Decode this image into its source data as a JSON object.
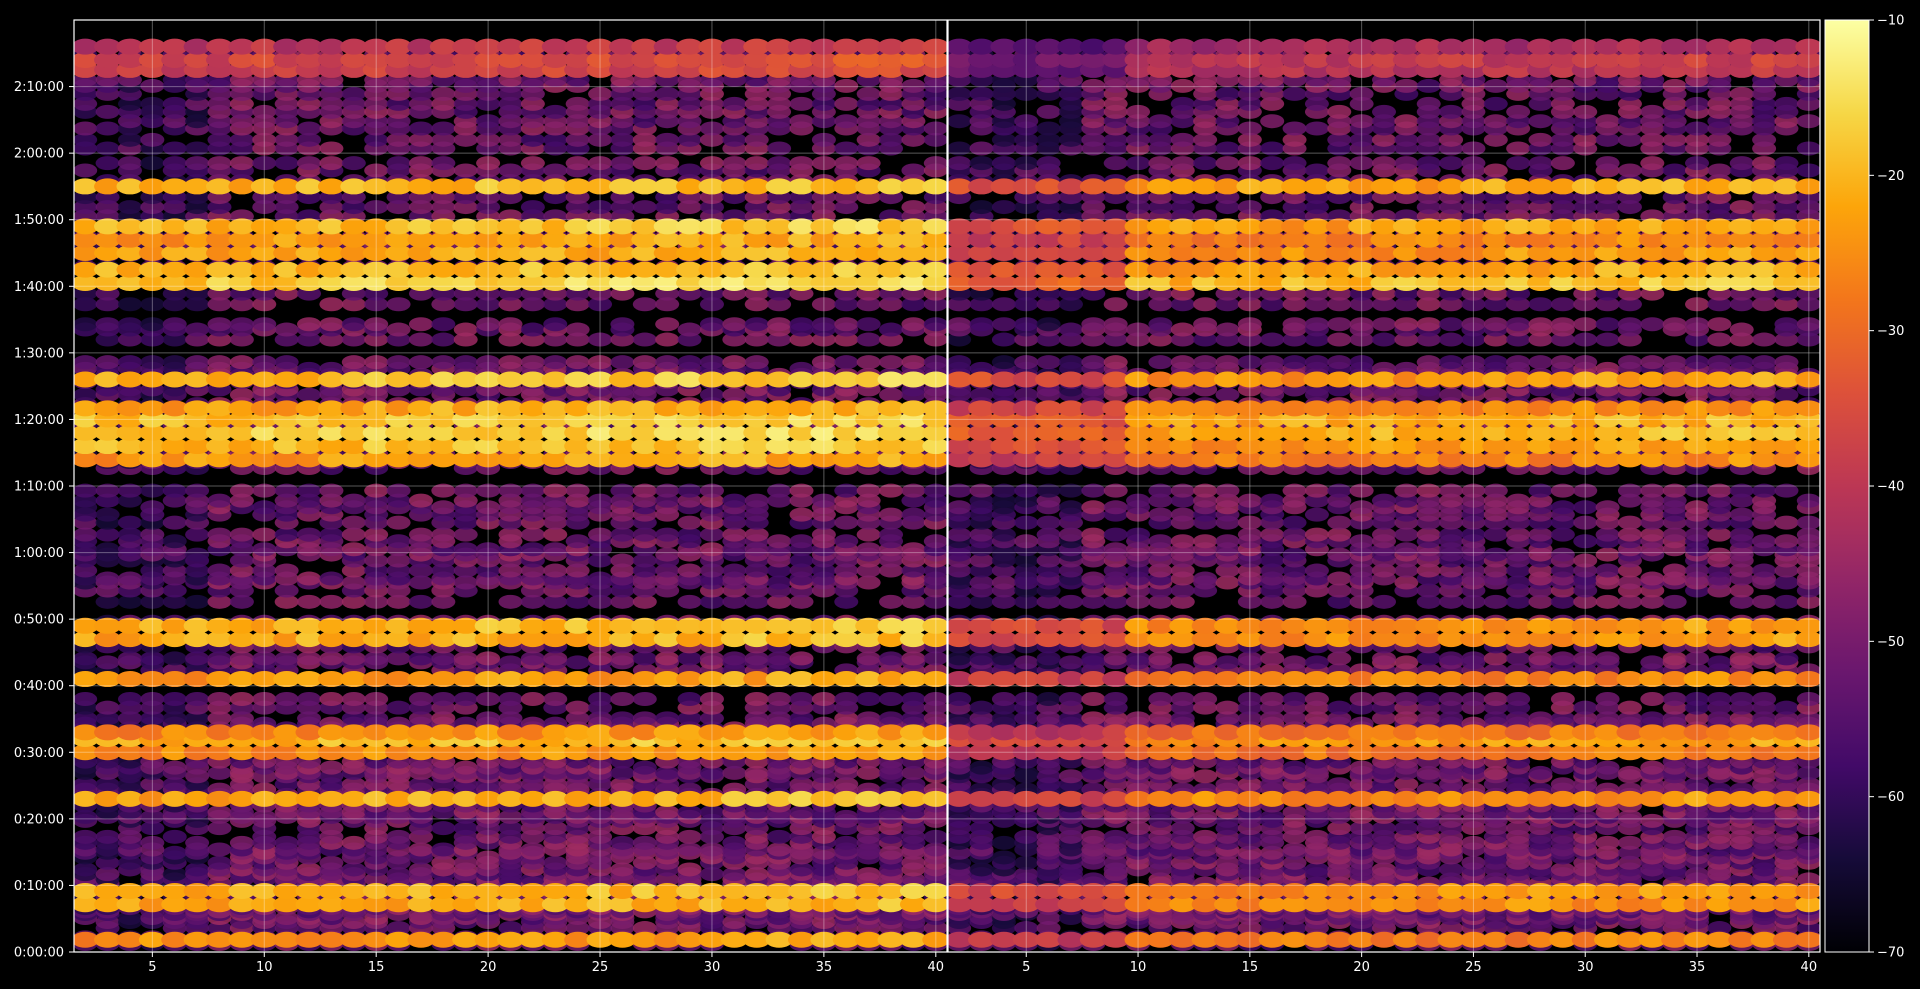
{
  "chart_data": [
    {
      "type": "heatmap",
      "panel": "left",
      "x_ticks": [
        5,
        10,
        15,
        20,
        25,
        30,
        35,
        40
      ],
      "xlim": [
        1.5,
        40.5
      ],
      "ylim_seconds": [
        0,
        8400
      ],
      "y_ticks": [
        "0:00:00",
        "0:10:00",
        "0:20:00",
        "0:30:00",
        "0:40:00",
        "0:50:00",
        "1:00:00",
        "1:10:00",
        "1:20:00",
        "1:30:00",
        "1:40:00",
        "1:50:00",
        "2:00:00",
        "2:10:00"
      ],
      "grid": true,
      "bright_bands": [
        {
          "time": "0:01:50",
          "level": -26
        },
        {
          "time": "0:07:10",
          "level": -24
        },
        {
          "time": "0:09:10",
          "level": -23
        },
        {
          "time": "0:23:00",
          "level": -23
        },
        {
          "time": "0:30:00",
          "level": -27
        },
        {
          "time": "0:32:00",
          "level": -22
        },
        {
          "time": "0:33:00",
          "level": -27
        },
        {
          "time": "0:41:00",
          "level": -26
        },
        {
          "time": "0:47:00",
          "level": -23
        },
        {
          "time": "0:49:00",
          "level": -22
        },
        {
          "time": "1:14:00",
          "level": -25
        },
        {
          "time": "1:16:00",
          "level": -21
        },
        {
          "time": "1:18:00",
          "level": -19
        },
        {
          "time": "1:20:00",
          "level": -20
        },
        {
          "time": "1:21:40",
          "level": -24
        },
        {
          "time": "1:26:00",
          "level": -21
        },
        {
          "time": "1:40:30",
          "level": -19
        },
        {
          "time": "1:42:30",
          "level": -22
        },
        {
          "time": "1:45:00",
          "level": -24
        },
        {
          "time": "1:47:00",
          "level": -25
        },
        {
          "time": "1:49:00",
          "level": -21
        },
        {
          "time": "1:55:00",
          "level": -22
        },
        {
          "time": "2:12:30",
          "level": -40
        },
        {
          "time": "2:14:00",
          "level": -38
        },
        {
          "time": "2:16:00",
          "level": -42
        }
      ]
    },
    {
      "type": "heatmap",
      "panel": "right",
      "x_ticks": [
        5,
        10,
        15,
        20,
        25,
        30,
        35,
        40
      ],
      "xlim": [
        1.5,
        40.5
      ],
      "ylim_seconds": [
        0,
        8400
      ],
      "grid": true,
      "bright_bands": [
        {
          "time": "0:01:50",
          "level": -30
        },
        {
          "time": "0:07:10",
          "level": -28
        },
        {
          "time": "0:09:10",
          "level": -27
        },
        {
          "time": "0:23:00",
          "level": -27
        },
        {
          "time": "0:30:00",
          "level": -31
        },
        {
          "time": "0:32:00",
          "level": -26
        },
        {
          "time": "0:33:00",
          "level": -31
        },
        {
          "time": "0:41:00",
          "level": -29
        },
        {
          "time": "0:47:00",
          "level": -27
        },
        {
          "time": "0:49:00",
          "level": -27
        },
        {
          "time": "1:14:00",
          "level": -29
        },
        {
          "time": "1:16:00",
          "level": -26
        },
        {
          "time": "1:18:00",
          "level": -23
        },
        {
          "time": "1:20:00",
          "level": -24
        },
        {
          "time": "1:21:40",
          "level": -28
        },
        {
          "time": "1:26:00",
          "level": -26
        },
        {
          "time": "1:40:30",
          "level": -22
        },
        {
          "time": "1:42:30",
          "level": -25
        },
        {
          "time": "1:45:00",
          "level": -27
        },
        {
          "time": "1:47:00",
          "level": -29
        },
        {
          "time": "1:49:00",
          "level": -25
        },
        {
          "time": "1:55:00",
          "level": -25
        },
        {
          "time": "2:12:30",
          "level": -44
        },
        {
          "time": "2:14:00",
          "level": -42
        },
        {
          "time": "2:16:00",
          "level": -46
        }
      ]
    }
  ],
  "colorbar": {
    "colormap": "inferno",
    "range": [
      -70,
      -10
    ],
    "ticks": [
      "−10",
      "−20",
      "−30",
      "−40",
      "−50",
      "−60",
      "−70"
    ],
    "tick_values": [
      -10,
      -20,
      -30,
      -40,
      -50,
      -60,
      -70
    ]
  },
  "colors": {
    "background": "#000000",
    "grid": "#ffffff",
    "axis": "#ffffff"
  }
}
